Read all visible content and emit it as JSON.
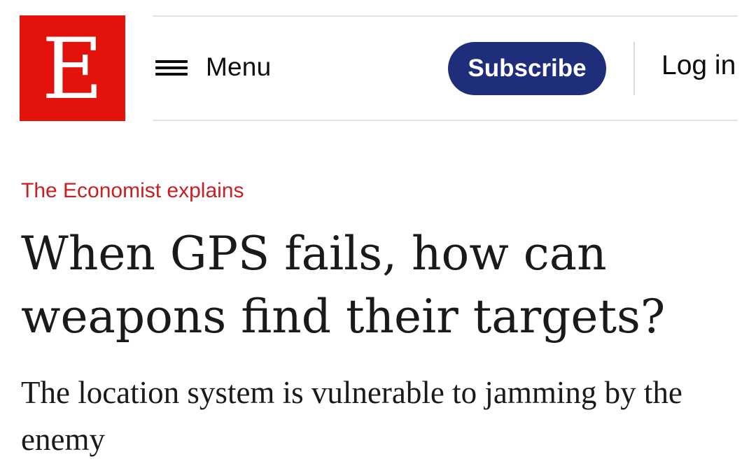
{
  "header": {
    "logo_letter": "E",
    "menu_label": "Menu",
    "subscribe_label": "Subscribe",
    "login_label": "Log in"
  },
  "article": {
    "rubric": "The Economist explains",
    "headline": "When GPS fails, how can weapons find their targets?",
    "standfirst": "The location system is vulnerable to jamming by the enemy"
  },
  "colors": {
    "brand_red": "#e3120b",
    "rubric_red": "#c91e23",
    "subscribe_blue": "#1f2e7a"
  },
  "icons": {
    "menu": "hamburger-icon"
  }
}
